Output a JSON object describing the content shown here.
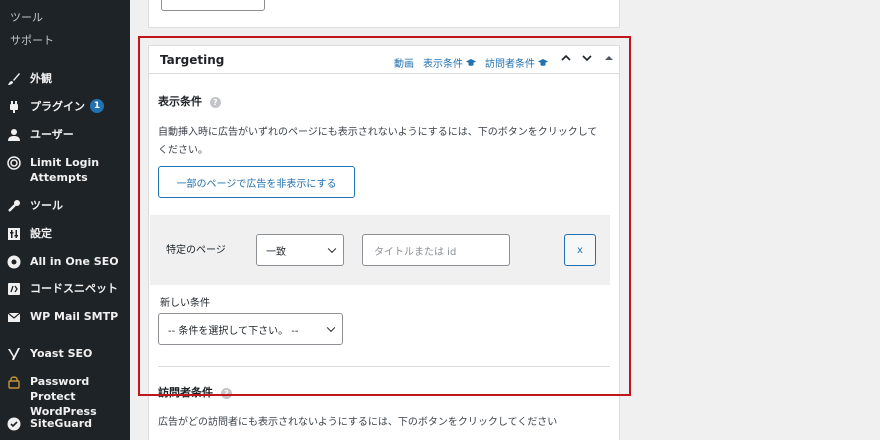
{
  "sidebar": {
    "submenu": [
      {
        "label": "ツール"
      },
      {
        "label": "サポート"
      }
    ],
    "menu": [
      {
        "label": "外観",
        "icon": "paintbrush-icon"
      },
      {
        "label": "プラグイン",
        "icon": "plugin-icon",
        "badge": "1"
      },
      {
        "label": "ユーザー",
        "icon": "user-icon"
      },
      {
        "label": "Limit Login Attempts",
        "icon": "fingerprint-icon"
      },
      {
        "label": "ツール",
        "icon": "wrench-icon"
      },
      {
        "label": "設定",
        "icon": "settings-icon"
      },
      {
        "label": "All in One SEO",
        "icon": "aioseo-icon"
      },
      {
        "label": "コードスニペット",
        "icon": "code-snippets-icon"
      },
      {
        "label": "WP Mail SMTP",
        "icon": "mail-icon"
      },
      {
        "label": "Yoast SEO",
        "icon": "yoast-icon"
      },
      {
        "label": "Password Protect WordPress",
        "icon": "lock-icon"
      },
      {
        "label": "SiteGuard",
        "icon": "siteguard-icon"
      }
    ]
  },
  "panel": {
    "title": "Targeting",
    "header_links": {
      "video": "動画",
      "display_conditions": "表示条件",
      "visitor_conditions": "訪問者条件"
    },
    "display": {
      "title": "表示条件",
      "description": "自動挿入時に広告がいずれのページにも表示されないようにするには、下のボタンをクリックしてください。",
      "hide_button": "一部のページで広告を非表示にする",
      "condition_label": "特定のページ",
      "match_value": "一致",
      "title_placeholder": "タイトルまたは id",
      "remove_button": "x",
      "new_condition_label": "新しい条件",
      "new_condition_select": "-- 条件を選択して下さい。 --"
    },
    "visitor": {
      "title": "訪問者条件",
      "description": "広告がどの訪問者にも表示されないようにするには、下のボタンをクリックしてください"
    }
  },
  "colors": {
    "accent": "#2271b1",
    "highlight": "#c0151b",
    "sidebar_bg": "#1d2327"
  }
}
